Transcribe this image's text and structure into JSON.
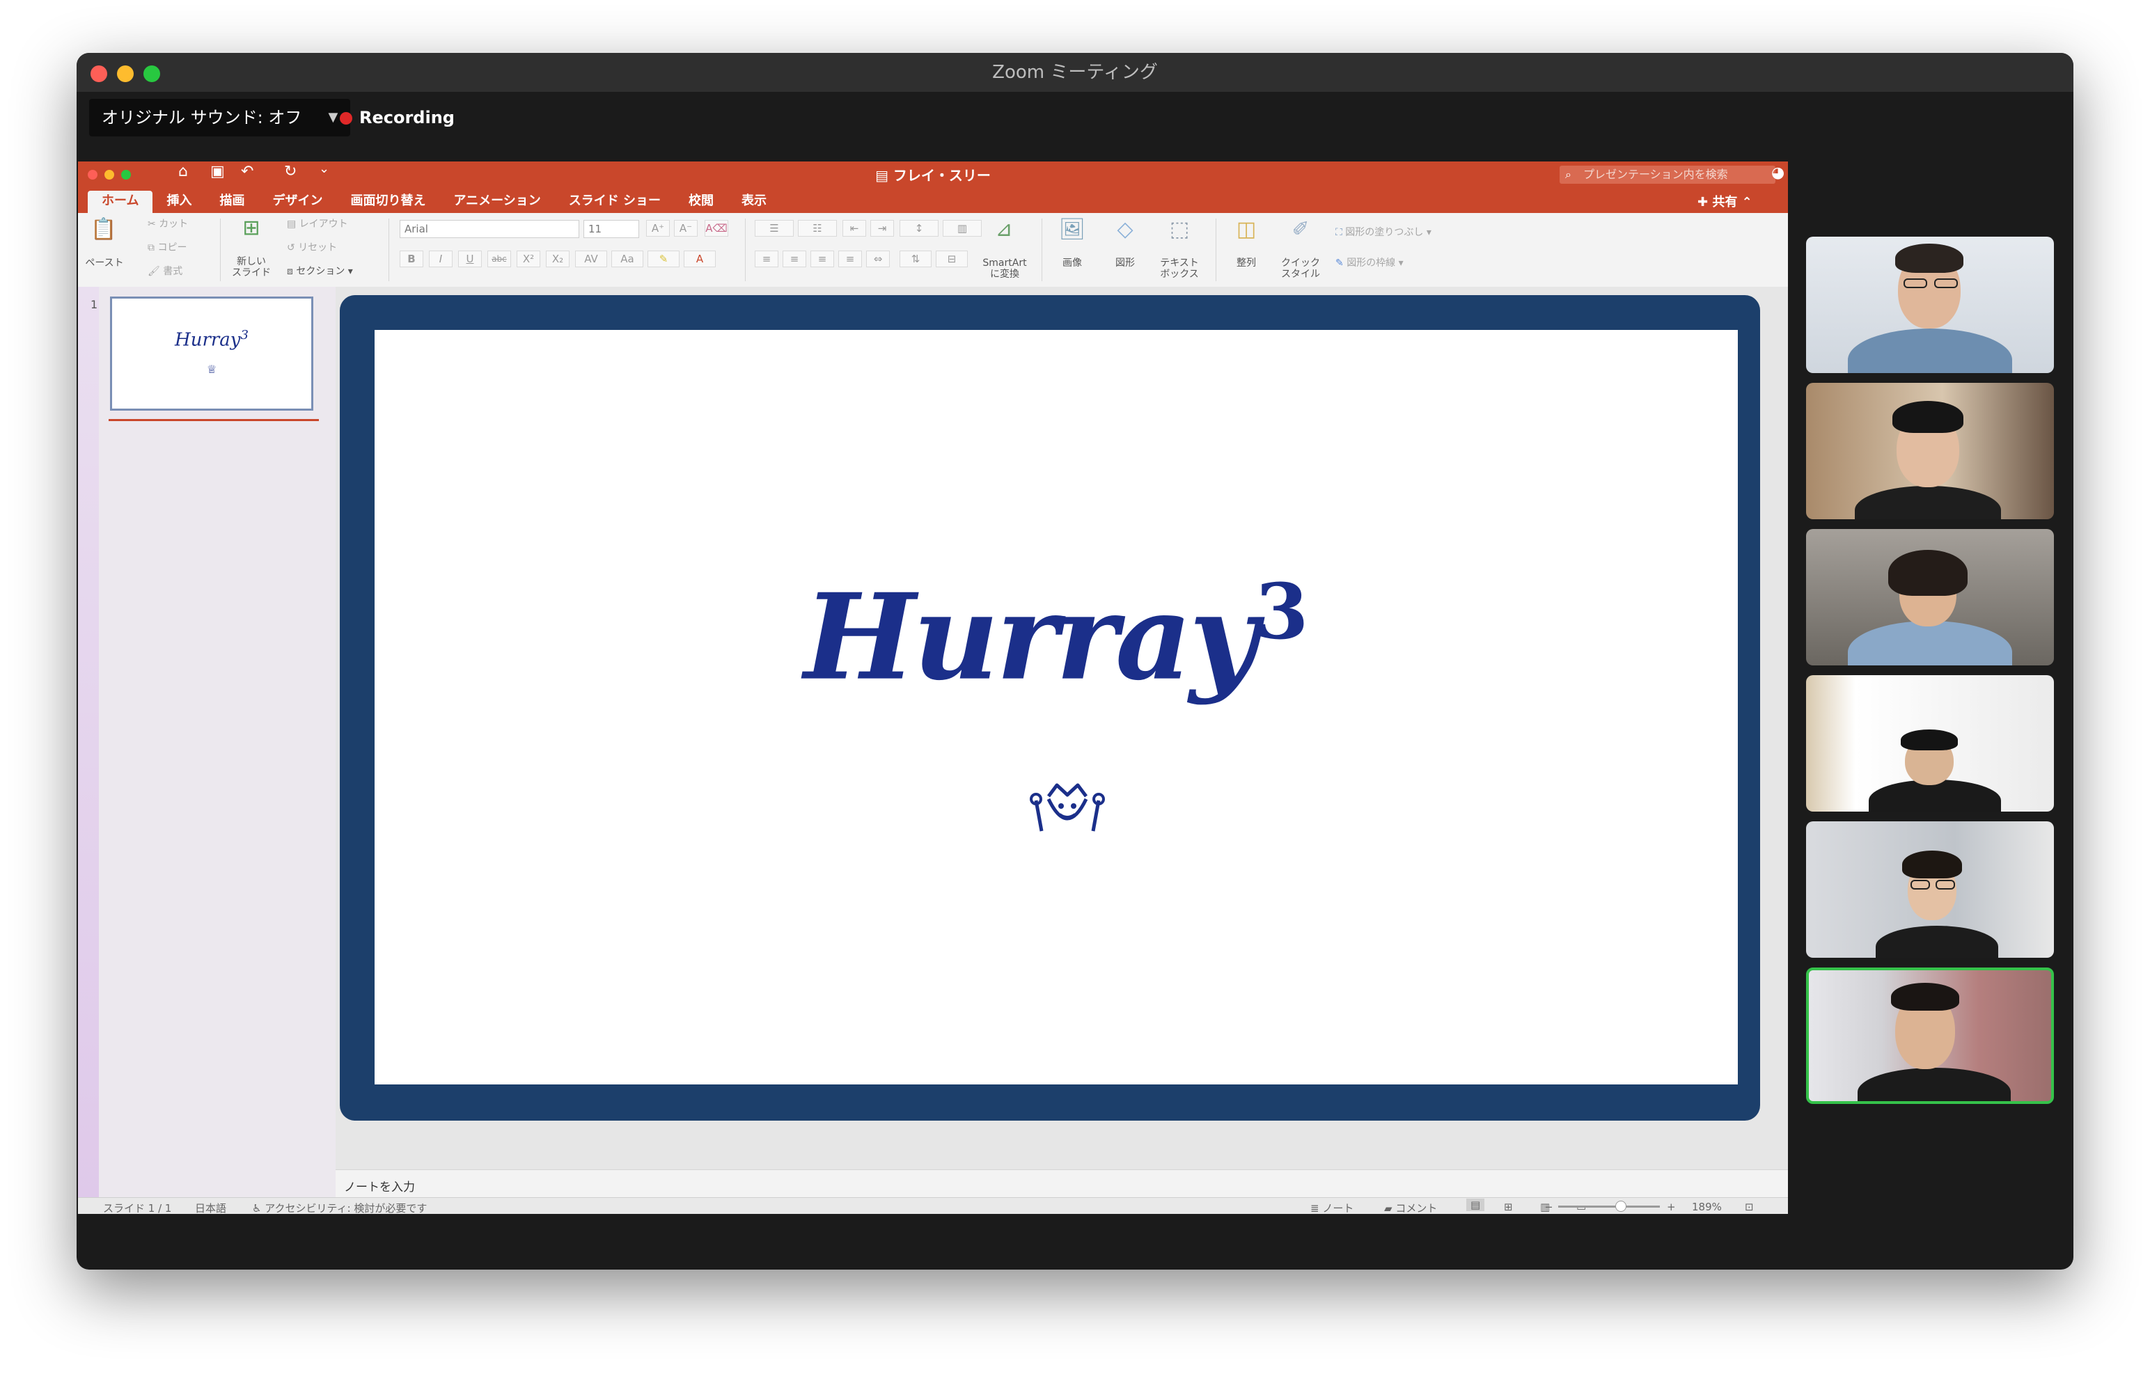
{
  "zoom": {
    "title": "Zoom ミーティング",
    "audio_label": "オリジナル サウンド: オフ",
    "recording_label": "Recording"
  },
  "ppt": {
    "document_title": "フレイ・スリー",
    "search_placeholder": "プレゼンテーション内を検索",
    "share_label": "共有",
    "tabs": [
      "ホーム",
      "挿入",
      "描画",
      "デザイン",
      "画面切り替え",
      "アニメーション",
      "スライド ショー",
      "校閲",
      "表示"
    ],
    "active_tab": "ホーム",
    "ribbon": {
      "paste": "ペースト",
      "cut": "カット",
      "copy": "コピー",
      "format": "書式",
      "new_slide_line1": "新しい",
      "new_slide_line2": "スライド",
      "layout": "レイアウト",
      "reset": "リセット",
      "section": "セクション",
      "font_name": "Arial",
      "font_size": "11",
      "smartart_line1": "SmartArt",
      "smartart_line2": "に変換",
      "picture": "画像",
      "shape": "図形",
      "textbox_line1": "テキスト",
      "textbox_line2": "ボックス",
      "arrange": "整列",
      "quick_style_line1": "クイック",
      "quick_style_line2": "スタイル",
      "shape_fill": "図形の塗りつぶし",
      "shape_outline": "図形の枠線"
    },
    "slide_number": "1",
    "slide": {
      "title": "Hurray",
      "superscript": "3"
    },
    "notes_placeholder": "ノートを入力",
    "status": {
      "slide_indicator": "スライド 1 / 1",
      "language": "日本語",
      "accessibility": "アクセシビリティ: 検討が必要です",
      "notes": "ノート",
      "comments": "コメント",
      "zoom": "189%"
    },
    "colors": {
      "accent": "#c9472b",
      "slide_frame": "#1c3f6b",
      "slide_text": "#1b2f8a"
    }
  },
  "participants": [
    {
      "active": false
    },
    {
      "active": false
    },
    {
      "active": false
    },
    {
      "active": false
    },
    {
      "active": false
    },
    {
      "active": true
    }
  ]
}
